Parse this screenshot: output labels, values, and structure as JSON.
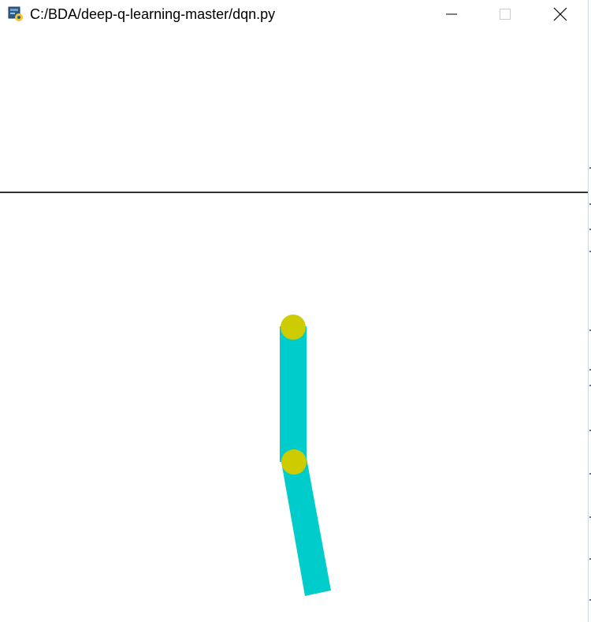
{
  "window": {
    "title": "C:/BDA/deep-q-learning-master/dqn.py",
    "app_icon": "python-icon",
    "controls": [
      "minimize-icon",
      "maximize-icon",
      "close-icon"
    ]
  },
  "scene": {
    "background": "#ffffff",
    "track_color": "#333333",
    "link_color": "#00cccc",
    "joint_color": "#cccc00",
    "links": 2,
    "joints": 2
  }
}
